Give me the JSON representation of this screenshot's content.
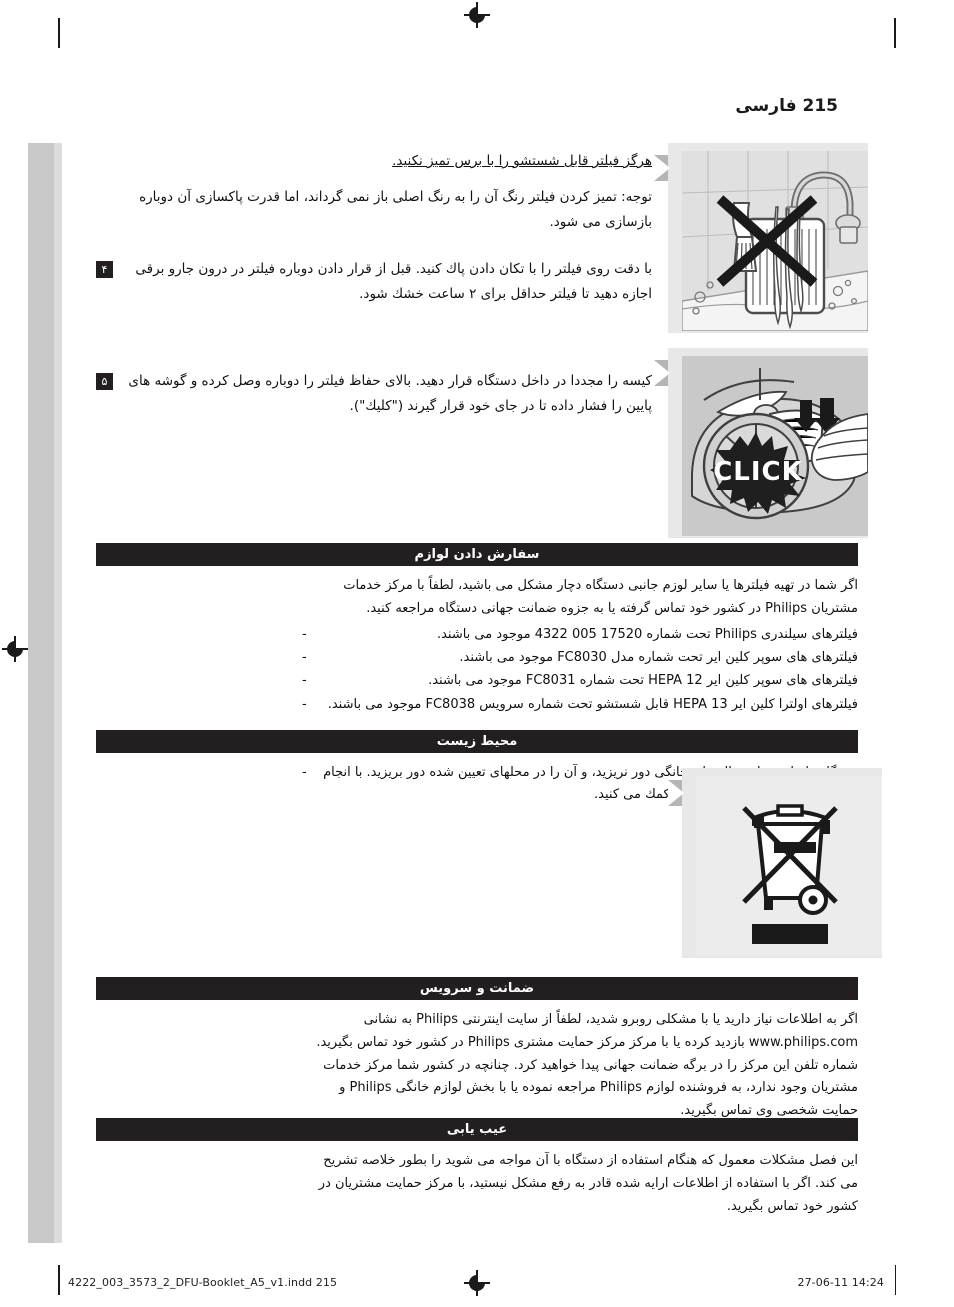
{
  "page": {
    "header": "215 فارسی",
    "page_number": "215",
    "language_label": "فارسی"
  },
  "intro": {
    "warning": "هرگز فیلتر قابل شستشو را با برس تمیز نکنید.",
    "note": "توجه: تمیز كردن فیلتر رنگ آن را به رنگ اصلی باز نمی گرداند، اما قدرت پاكسازی آن دوباره بازسازی می شود."
  },
  "steps": [
    {
      "number": "۴",
      "text": "با دقت روی فیلتر را با تكان دادن پاك كنید. قبل از قرار دادن دوباره فیلتر در درون جارو برقی اجازه دهید تا فیلتر حداقل برای ۲ ساعت خشك شود."
    },
    {
      "number": "۵",
      "text": "كیسه را مجددا در داخل دستگاه قرار دهید. بالای حفاظ فیلتر را دوباره وصل كرده و گوشه های پایین را فشار داده تا در جای خود قرار گیرند (\"كلیك\")."
    }
  ],
  "illustrations": [
    {
      "name": "no-brush-filter-under-tap",
      "caption": "",
      "badge": ""
    },
    {
      "name": "click-filter-cover",
      "caption": "CLICK",
      "badge": ""
    },
    {
      "name": "weee-crossed-out-wheelie-bin",
      "caption": "",
      "badge": ""
    }
  ],
  "sections": [
    {
      "id": "ordering-accessories",
      "title": "سفارش دادن لوازم",
      "paragraphs": [
        "اگر شما در تهیه فیلترها یا سایر لوزم جانبی دستگاه دچار مشكل می باشید، لطفاً با مركز خدمات مشتریان Philips در كشور خود تماس گرفته یا به جزوه ضمانت جهانی دستگاه مراجعه كنید."
      ],
      "bullets": [
        "فیلترهای سیلندری Philips تحت شماره 17520 005 4322 موجود می باشند.",
        "فیلترهای های سوپر كلین ایر تحت شماره مدل FC8030 موجود می باشند.",
        "فیلترهای های سوپر كلین ایر HEPA 12 تحت شماره FC8031 موجود می باشند.",
        "فیلترهای اولترا كلین ایر HEPA 13 قابل شستشو تحت شماره سرویس FC8038 موجود می باشند."
      ]
    },
    {
      "id": "environment",
      "title": "محیط زیست",
      "paragraphs": [],
      "bullets": [
        "دستگاه را مانند سایر زباله های خانگی دور نریزید، و آن را در محلهای تعیین شده دور بریزید. با انجام این كار شما به حفظ محیط زیست كمك می كنید."
      ]
    },
    {
      "id": "warranty-and-service",
      "title": "ضمانت و سرویس",
      "paragraphs": [
        "اگر به اطلاعات نیاز دارید یا با مشكلی روبرو شدید، لطفاً از سایت اینترنتی Philips به نشانی www.philips.com بازدید كرده یا با مركز مركز حمایت مشتری Philips در كشور خود تماس بگیرید. شماره تلفن این مركز را در برگه ضمانت جهانی پیدا خواهید كرد. چنانچه در كشور شما مركز خدمات مشتریان وجود ندارد، به فروشنده لوازم Philips مراجعه نموده یا با بخش لوازم خانگی Philips و حمایت شخصی وی تماس بگیرید."
      ],
      "bullets": []
    },
    {
      "id": "troubleshooting",
      "title": "عیب یابی",
      "paragraphs": [
        "این فصل مشكلات معمول كه هنگام استفاده از دستگاه با آن مواجه می شوید را بطور خلاصه تشریح می كند. اگر با استفاده از اطلاعات ارایه شده قادر به رفع مشكل نیستید، با مركز حمایت مشتریان در كشور خود تماس بگیرید."
      ],
      "bullets": []
    }
  ],
  "footer": {
    "file": "4222_003_3573_2_DFU-Booklet_A5_v1.indd   215",
    "timestamp": "27-06-11   14:24"
  },
  "colors": {
    "section_bar": "#231f20",
    "image_panel": "#e8e8e8",
    "margin_bar": "#c8c8c8",
    "text": "#111111"
  }
}
